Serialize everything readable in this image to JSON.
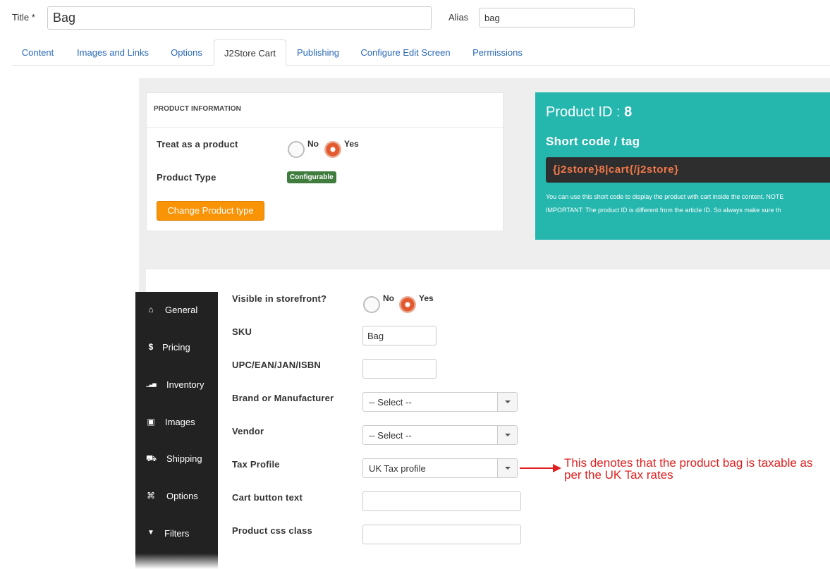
{
  "title_field": {
    "label": "Title *",
    "value": "Bag"
  },
  "alias_field": {
    "label": "Alias",
    "value": "bag"
  },
  "tabs": [
    {
      "label": "Content"
    },
    {
      "label": "Images and Links"
    },
    {
      "label": "Options"
    },
    {
      "label": "J2Store Cart"
    },
    {
      "label": "Publishing"
    },
    {
      "label": "Configure Edit Screen"
    },
    {
      "label": "Permissions"
    }
  ],
  "active_tab": "J2Store Cart",
  "product_info": {
    "heading": "PRODUCT INFORMATION",
    "treat_label": "Treat as a product",
    "no_label": "No",
    "yes_label": "Yes",
    "treat_selected": "Yes",
    "type_label": "Product Type",
    "type_badge": "Configurable",
    "change_button": "Change Product type"
  },
  "shortcode_panel": {
    "id_label": "Product ID : ",
    "id_value": "8",
    "shortcode_label": "Short code / tag",
    "shortcode": "{j2store}8|cart{/j2store}",
    "note_1": "You can use this short code to display the product with cart inside the content. NOTE",
    "note_2": "IMPORTANT: The product ID is different from the article ID. So always make sure th",
    "accent_color": "#25b6ae"
  },
  "sidenav": [
    {
      "label": "General",
      "icon": "home-icon",
      "glyph": "⌂"
    },
    {
      "label": "Pricing",
      "icon": "dollar-icon",
      "glyph": "$"
    },
    {
      "label": "Inventory",
      "icon": "signal-icon",
      "glyph": "▁▃▅"
    },
    {
      "label": "Images",
      "icon": "image-icon",
      "glyph": "▣"
    },
    {
      "label": "Shipping",
      "icon": "truck-icon",
      "glyph": "⛟"
    },
    {
      "label": "Options",
      "icon": "sitemap-icon",
      "glyph": "⌘"
    },
    {
      "label": "Filters",
      "icon": "filter-icon",
      "glyph": "▼"
    }
  ],
  "general_form": {
    "visible_label": "Visible in storefront?",
    "no_label": "No",
    "yes_label": "Yes",
    "visible_selected": "Yes",
    "sku_label": "SKU",
    "sku_value": "Bag",
    "upc_label": "UPC/EAN/JAN/ISBN",
    "upc_value": "",
    "brand_label": "Brand or Manufacturer",
    "brand_value": "-- Select --",
    "vendor_label": "Vendor",
    "vendor_value": "-- Select --",
    "tax_label": "Tax Profile",
    "tax_value": "UK Tax profile",
    "cart_text_label": "Cart button text",
    "cart_text_value": "",
    "css_class_label": "Product css class",
    "css_class_value": ""
  },
  "annotation": {
    "line_1": "This denotes that the product bag is taxable as",
    "line_2": "per the UK Tax rates",
    "color": "#e02020"
  }
}
